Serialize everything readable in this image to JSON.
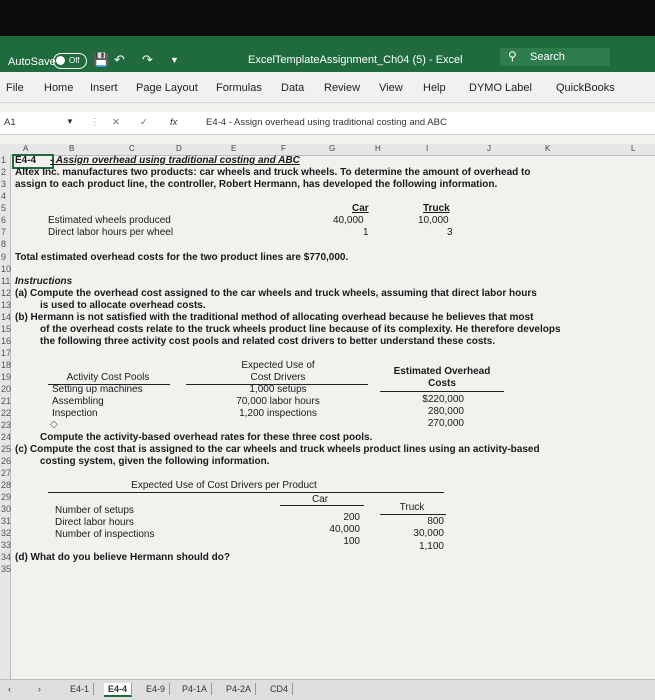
{
  "titlebar": {
    "autosave_label": "AutoSave",
    "autosave_state": "Off",
    "doc_title": "ExcelTemplateAssignment_Ch04 (5)  -  Excel",
    "search_placeholder": "Search"
  },
  "menu": [
    "File",
    "Home",
    "Insert",
    "Page Layout",
    "Formulas",
    "Data",
    "Review",
    "View",
    "Help",
    "DYMO Label",
    "QuickBooks"
  ],
  "formula_bar": {
    "name_box": "A1",
    "fx": "fx",
    "content": "E4-4 - Assign overhead using traditional costing and ABC"
  },
  "columns": [
    "A",
    "B",
    "C",
    "D",
    "E",
    "F",
    "G",
    "H",
    "I",
    "J",
    "K",
    "L"
  ],
  "rows": [
    "1",
    "2",
    "3",
    "4",
    "5",
    "6",
    "7",
    "8",
    "9",
    "10",
    "11",
    "12",
    "13",
    "14",
    "15",
    "16",
    "17",
    "18",
    "19",
    "20",
    "21",
    "22",
    "23",
    "24",
    "25",
    "26",
    "27",
    "28",
    "29",
    "30",
    "31",
    "32",
    "33",
    "34",
    "35"
  ],
  "sheet": {
    "r1_id": "E4-4",
    "r1_title": "- Assign overhead using traditional costing and ABC",
    "r2": "Altex Inc. manufactures two products: car wheels and truck wheels. To determine the amount of overhead to",
    "r3": "assign to each product line, the controller, Robert Hermann, has developed the following information.",
    "car_header": "Car",
    "truck_header": "Truck",
    "r6_label": "Estimated wheels produced",
    "r6_car": "40,000",
    "r6_truck": "10,000",
    "r7_label": "Direct labor hours per wheel",
    "r7_car": "1",
    "r7_truck": "3",
    "r9": "Total estimated overhead costs for the two product lines are $770,000.",
    "r11": "Instructions",
    "r12": "(a) Compute the overhead cost assigned to the car wheels and truck wheels, assuming that direct labor hours",
    "r13": "is used to allocate overhead costs.",
    "r14": "(b) Hermann is not satisfied with the traditional method of allocating overhead because he believes that most",
    "r15": "of the overhead costs relate to the truck wheels product line because of its complexity. He therefore develops",
    "r16": "the following three activity cost pools and related cost drivers to better understand these costs.",
    "h_pools": "Activity Cost Pools",
    "h_expected_1": "Expected Use of",
    "h_expected_2": "Cost Drivers",
    "h_overhead_1": "Estimated Overhead",
    "h_overhead_2": "Costs",
    "pools": [
      {
        "name": "Setting up machines",
        "driver": "1,000 setups",
        "cost": "$220,000"
      },
      {
        "name": "Assembling",
        "driver": "70,000 labor hours",
        "cost": "280,000"
      },
      {
        "name": "Inspection",
        "driver": "1,200 inspections",
        "cost": "270,000"
      }
    ],
    "r24": "Compute the activity-based overhead rates for these three cost pools.",
    "r25": "(c) Compute the cost that is assigned to the car wheels and truck wheels product lines using an activity-based",
    "r26": "costing system, given the following information.",
    "r28": "Expected Use of Cost Drivers per Product",
    "c_car": "Car",
    "c_truck": "Truck",
    "usage": [
      {
        "name": "Number of setups",
        "car": "200",
        "truck": "800"
      },
      {
        "name": "Direct labor hours",
        "car": "40,000",
        "truck": "30,000"
      },
      {
        "name": "Number of inspections",
        "car": "100",
        "truck": "1,100"
      }
    ],
    "r34": "(d) What do you believe Hermann should do?"
  },
  "tabs": [
    "E4-1",
    "E4-4",
    "E4-9",
    "P4-1A",
    "P4-2A",
    "CD4"
  ],
  "active_tab": "E4-4"
}
